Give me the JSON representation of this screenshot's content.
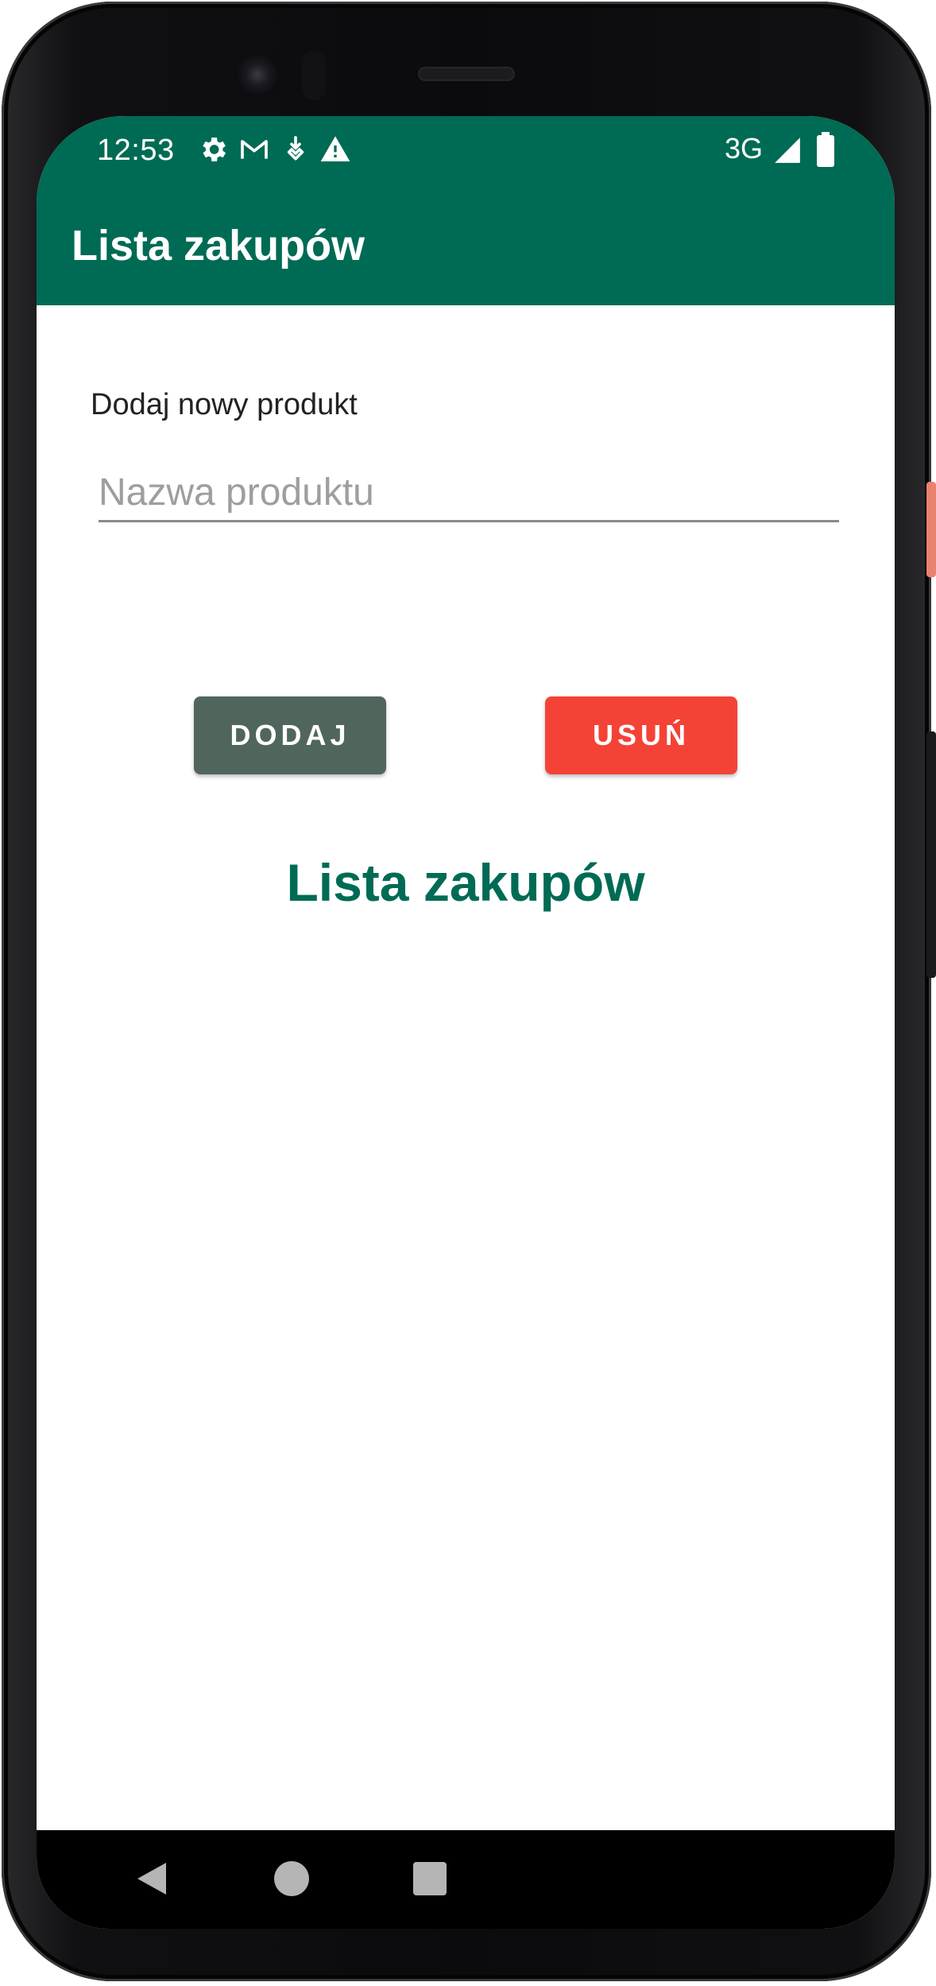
{
  "status_bar": {
    "time": "12:53",
    "icons": [
      "gear-icon",
      "gmail-icon",
      "download-icon",
      "warning-icon"
    ],
    "network": "3G",
    "signal_icon": "signal-icon",
    "battery_icon": "battery-icon"
  },
  "app_bar": {
    "title": "Lista zakupów"
  },
  "form": {
    "label": "Dodaj nowy produkt",
    "input_placeholder": "Nazwa produktu",
    "input_value": ""
  },
  "buttons": {
    "add_label": "DODAJ",
    "remove_label": "USUŃ"
  },
  "list": {
    "title": "Lista zakupów"
  },
  "nav": {
    "back": "back-icon",
    "home": "home-icon",
    "recents": "recents-icon"
  },
  "colors": {
    "primary": "#006b54",
    "add_button": "#50665c",
    "remove_button": "#f44336"
  }
}
